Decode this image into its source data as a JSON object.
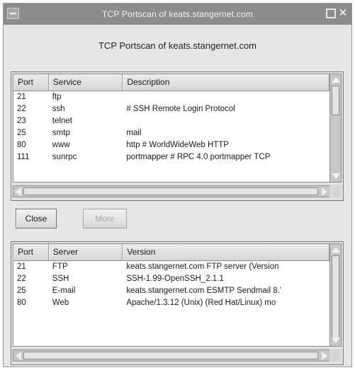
{
  "window": {
    "title": "TCP Portscan of keats.stangernet.com",
    "heading": "TCP Portscan of keats.stangernet.com"
  },
  "services_table": {
    "headers": [
      "Port",
      "Service",
      "Description"
    ],
    "rows": [
      [
        "21",
        "ftp",
        ""
      ],
      [
        "22",
        "ssh",
        "# SSH Remote Login Protocol"
      ],
      [
        "23",
        "telnet",
        ""
      ],
      [
        "25",
        "smtp",
        "mail"
      ],
      [
        "80",
        "www",
        "http  # WorldWideWeb HTTP"
      ],
      [
        "111",
        "sunrpc",
        "portmapper # RPC 4.0 portmapper TCP"
      ]
    ]
  },
  "buttons": {
    "close": "Close",
    "more": "More"
  },
  "servers_table": {
    "headers": [
      "Port",
      "Server",
      "Version"
    ],
    "rows": [
      [
        "21",
        "FTP",
        "keats.stangernet.com FTP server (Version"
      ],
      [
        "22",
        "SSH",
        "SSH-1.99-OpenSSH_2.1.1"
      ],
      [
        "25",
        "E-mail",
        "keats.stangernet.com ESMTP Sendmail 8.'"
      ],
      [
        "80",
        "Web",
        "Apache/1.3.12 (Unix)  (Red Hat/Linux) mo"
      ]
    ]
  },
  "icons": {
    "window_menu": "window-menu-icon",
    "maximize": "maximize-icon",
    "close": "close-icon"
  }
}
